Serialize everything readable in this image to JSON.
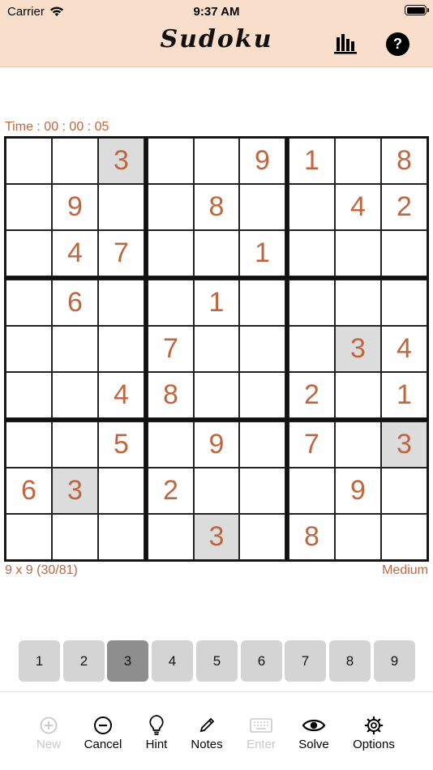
{
  "status_bar": {
    "carrier": "Carrier",
    "time": "9:37 AM"
  },
  "header": {
    "title": "Sudoku",
    "stats_icon": "bar-chart-icon",
    "help_label": "?"
  },
  "timer": "Time : 00 : 00 : 05",
  "board": {
    "rows": [
      [
        "",
        "",
        "3",
        "",
        "",
        "9",
        "1",
        "",
        "8"
      ],
      [
        "",
        "9",
        "",
        "",
        "8",
        "",
        "",
        "4",
        "2"
      ],
      [
        "",
        "4",
        "7",
        "",
        "",
        "1",
        "",
        "",
        ""
      ],
      [
        "",
        "6",
        "",
        "",
        "1",
        "",
        "",
        "",
        ""
      ],
      [
        "",
        "",
        "",
        "7",
        "",
        "",
        "",
        "3",
        "4"
      ],
      [
        "",
        "",
        "4",
        "8",
        "",
        "",
        "2",
        "",
        "1"
      ],
      [
        "",
        "",
        "5",
        "",
        "9",
        "",
        "7",
        "",
        "3"
      ],
      [
        "6",
        "3",
        "",
        "2",
        "",
        "",
        "",
        "9",
        ""
      ],
      [
        "",
        "",
        "",
        "",
        "3",
        "",
        "8",
        "",
        ""
      ]
    ],
    "highlighted_cells": [
      [
        0,
        2
      ],
      [
        4,
        7
      ],
      [
        6,
        8
      ],
      [
        7,
        1
      ],
      [
        8,
        4
      ]
    ]
  },
  "grid_info": "9 x 9 (30/81)",
  "difficulty": "Medium",
  "number_pad": {
    "buttons": [
      "1",
      "2",
      "3",
      "4",
      "5",
      "6",
      "7",
      "8",
      "9"
    ],
    "selected": "3"
  },
  "toolbar": {
    "new": {
      "label": "New",
      "icon": "plus-circle-icon",
      "enabled": false
    },
    "cancel": {
      "label": "Cancel",
      "icon": "minus-circle-icon",
      "enabled": true
    },
    "hint": {
      "label": "Hint",
      "icon": "lightbulb-icon",
      "enabled": true
    },
    "notes": {
      "label": "Notes",
      "icon": "pencil-icon",
      "enabled": true
    },
    "enter": {
      "label": "Enter",
      "icon": "keyboard-icon",
      "enabled": false
    },
    "solve": {
      "label": "Solve",
      "icon": "eye-icon",
      "enabled": true
    },
    "options": {
      "label": "Options",
      "icon": "gear-icon",
      "enabled": true
    }
  },
  "colors": {
    "accent": "#c0663f",
    "header_bg": "#f9decc",
    "highlight": "#dcdcdc",
    "key_bg": "#d4d4d4",
    "key_selected": "#8e8e8e"
  }
}
